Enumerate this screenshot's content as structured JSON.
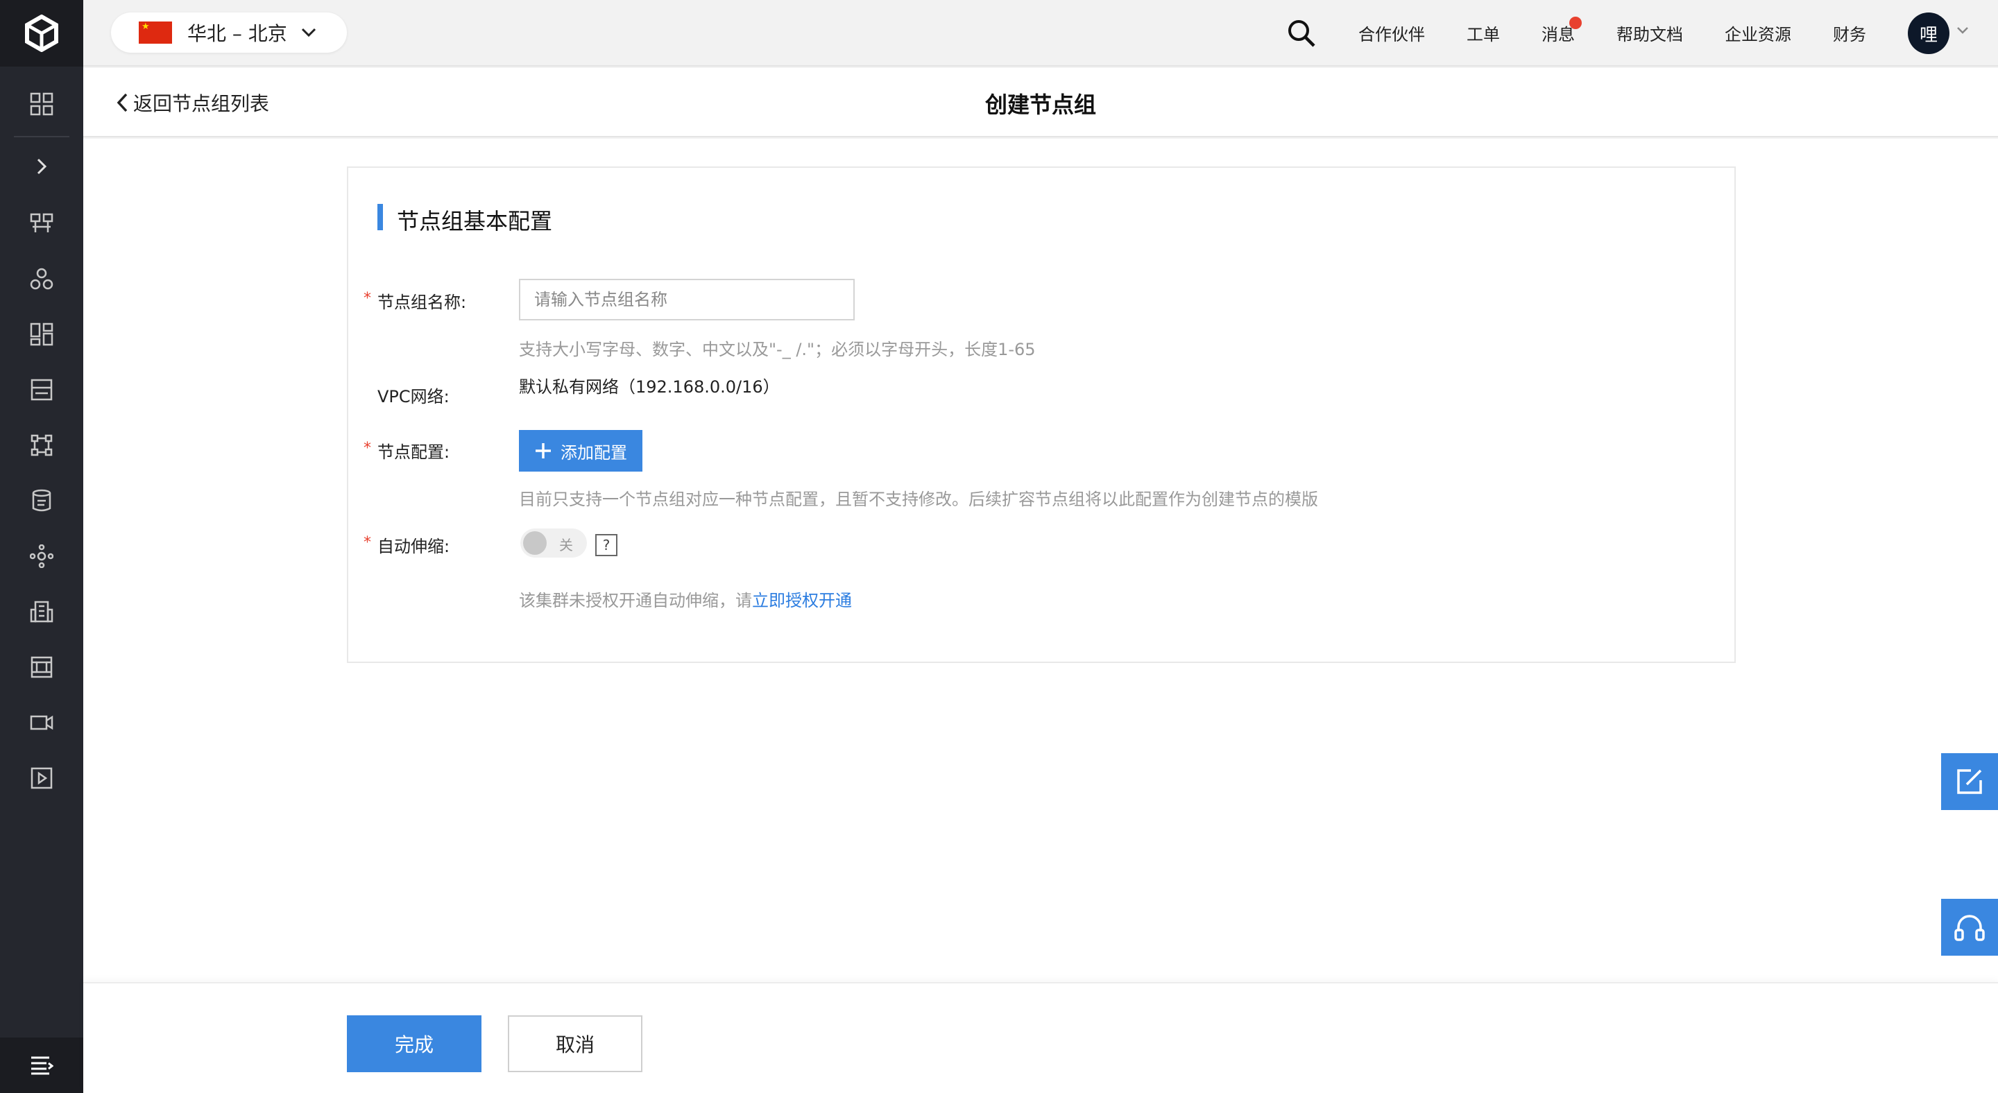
{
  "header": {
    "region": "华北 – 北京",
    "nav": [
      "合作伙伴",
      "工单",
      "消息",
      "帮助文档",
      "企业资源",
      "财务"
    ],
    "avatar_text": "哩"
  },
  "subheader": {
    "back_label": "返回节点组列表",
    "title": "创建节点组"
  },
  "form": {
    "section_title": "节点组基本配置",
    "name_label": "节点组名称:",
    "name_placeholder": "请输入节点组名称",
    "name_value": "",
    "name_hint": "支持大小写字母、数字、中文以及\"-_ /.\"；必须以字母开头，长度1-65",
    "vpc_label": "VPC网络:",
    "vpc_value": "默认私有网络（192.168.0.0/16）",
    "node_config_label": "节点配置:",
    "add_config_label": "添加配置",
    "node_config_hint": "目前只支持一个节点组对应一种节点配置，且暂不支持修改。后续扩容节点组将以此配置作为创建节点的模版",
    "autoscale_label": "自动伸缩:",
    "autoscale_toggle_text": "关",
    "autoscale_enabled": false,
    "help_mark": "?",
    "auth_text": "该集群未授权开通自动伸缩，请",
    "auth_link": "立即授权开通"
  },
  "footer": {
    "done_label": "完成",
    "cancel_label": "取消"
  },
  "colors": {
    "accent": "#3a87e0",
    "sidebar_bg": "#25272e",
    "required": "#e8412f",
    "link": "#2c7de0"
  }
}
